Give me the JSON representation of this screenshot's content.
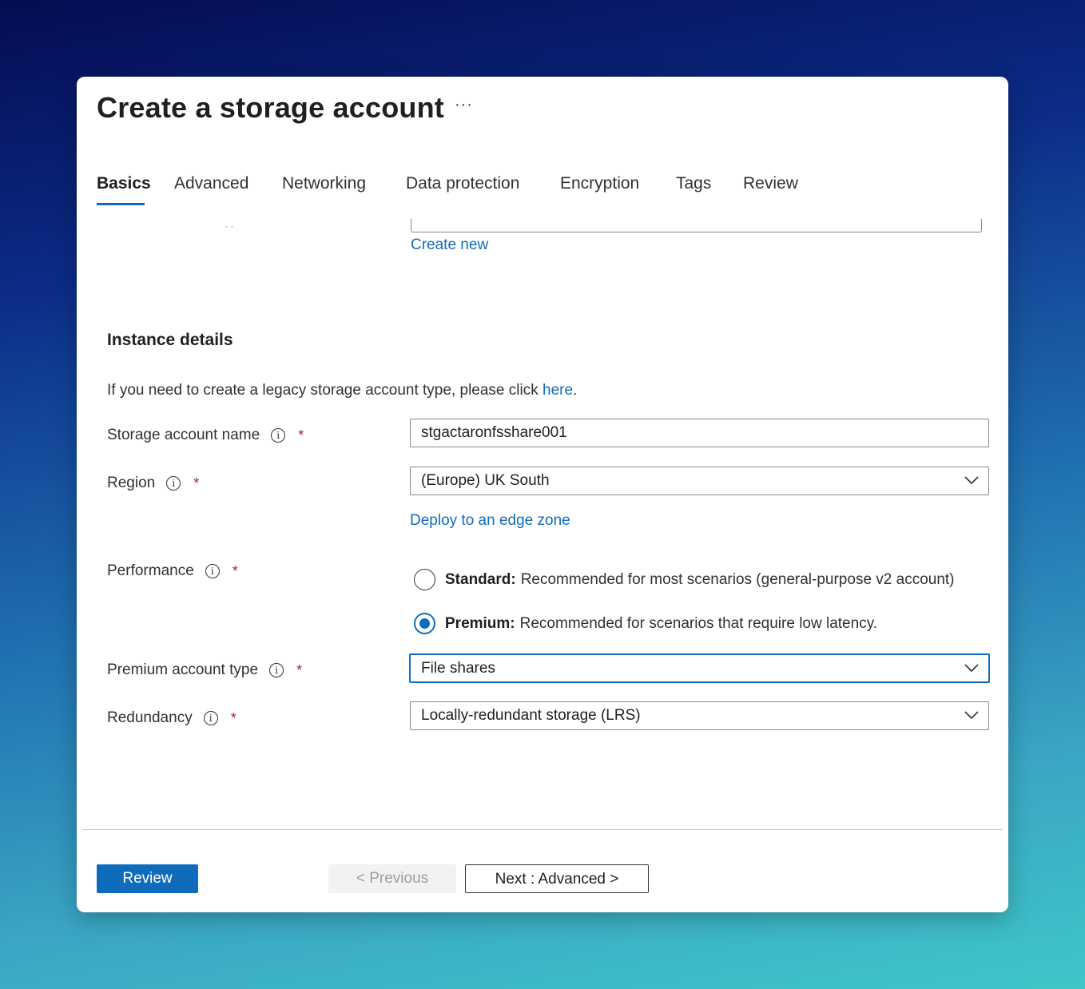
{
  "header": {
    "title": "Create a storage account",
    "more_label": "···"
  },
  "tabs": [
    {
      "label": "Basics",
      "active": true
    },
    {
      "label": "Advanced"
    },
    {
      "label": "Networking"
    },
    {
      "label": "Data protection"
    },
    {
      "label": "Encryption"
    },
    {
      "label": "Tags"
    },
    {
      "label": "Review"
    }
  ],
  "resource_group": {
    "create_new_link": "Create new"
  },
  "instance": {
    "section_title": "Instance details",
    "legacy_text": "If you need to create a legacy storage account type, please click ",
    "legacy_link": "here",
    "legacy_suffix": "."
  },
  "fields": {
    "storage_name": {
      "label": "Storage account name",
      "value": "stgactaronfsshare001"
    },
    "region": {
      "label": "Region",
      "value": "(Europe) UK South",
      "edge_zone_link": "Deploy to an edge zone"
    },
    "performance": {
      "label": "Performance",
      "standard": {
        "title": "Standard:",
        "desc": "Recommended for most scenarios (general-purpose v2 account)",
        "checked": false
      },
      "premium": {
        "title": "Premium:",
        "desc": "Recommended for scenarios that require low latency.",
        "checked": true
      }
    },
    "premium_type": {
      "label": "Premium account type",
      "value": "File shares"
    },
    "redundancy": {
      "label": "Redundancy",
      "value": "Locally-redundant storage (LRS)"
    }
  },
  "required_mark": "*",
  "info_glyph": "i",
  "footer": {
    "review": "Review",
    "previous": "< Previous",
    "next": "Next : Advanced >"
  },
  "colors": {
    "accent": "#0f6cbd",
    "required": "#a4262c"
  }
}
